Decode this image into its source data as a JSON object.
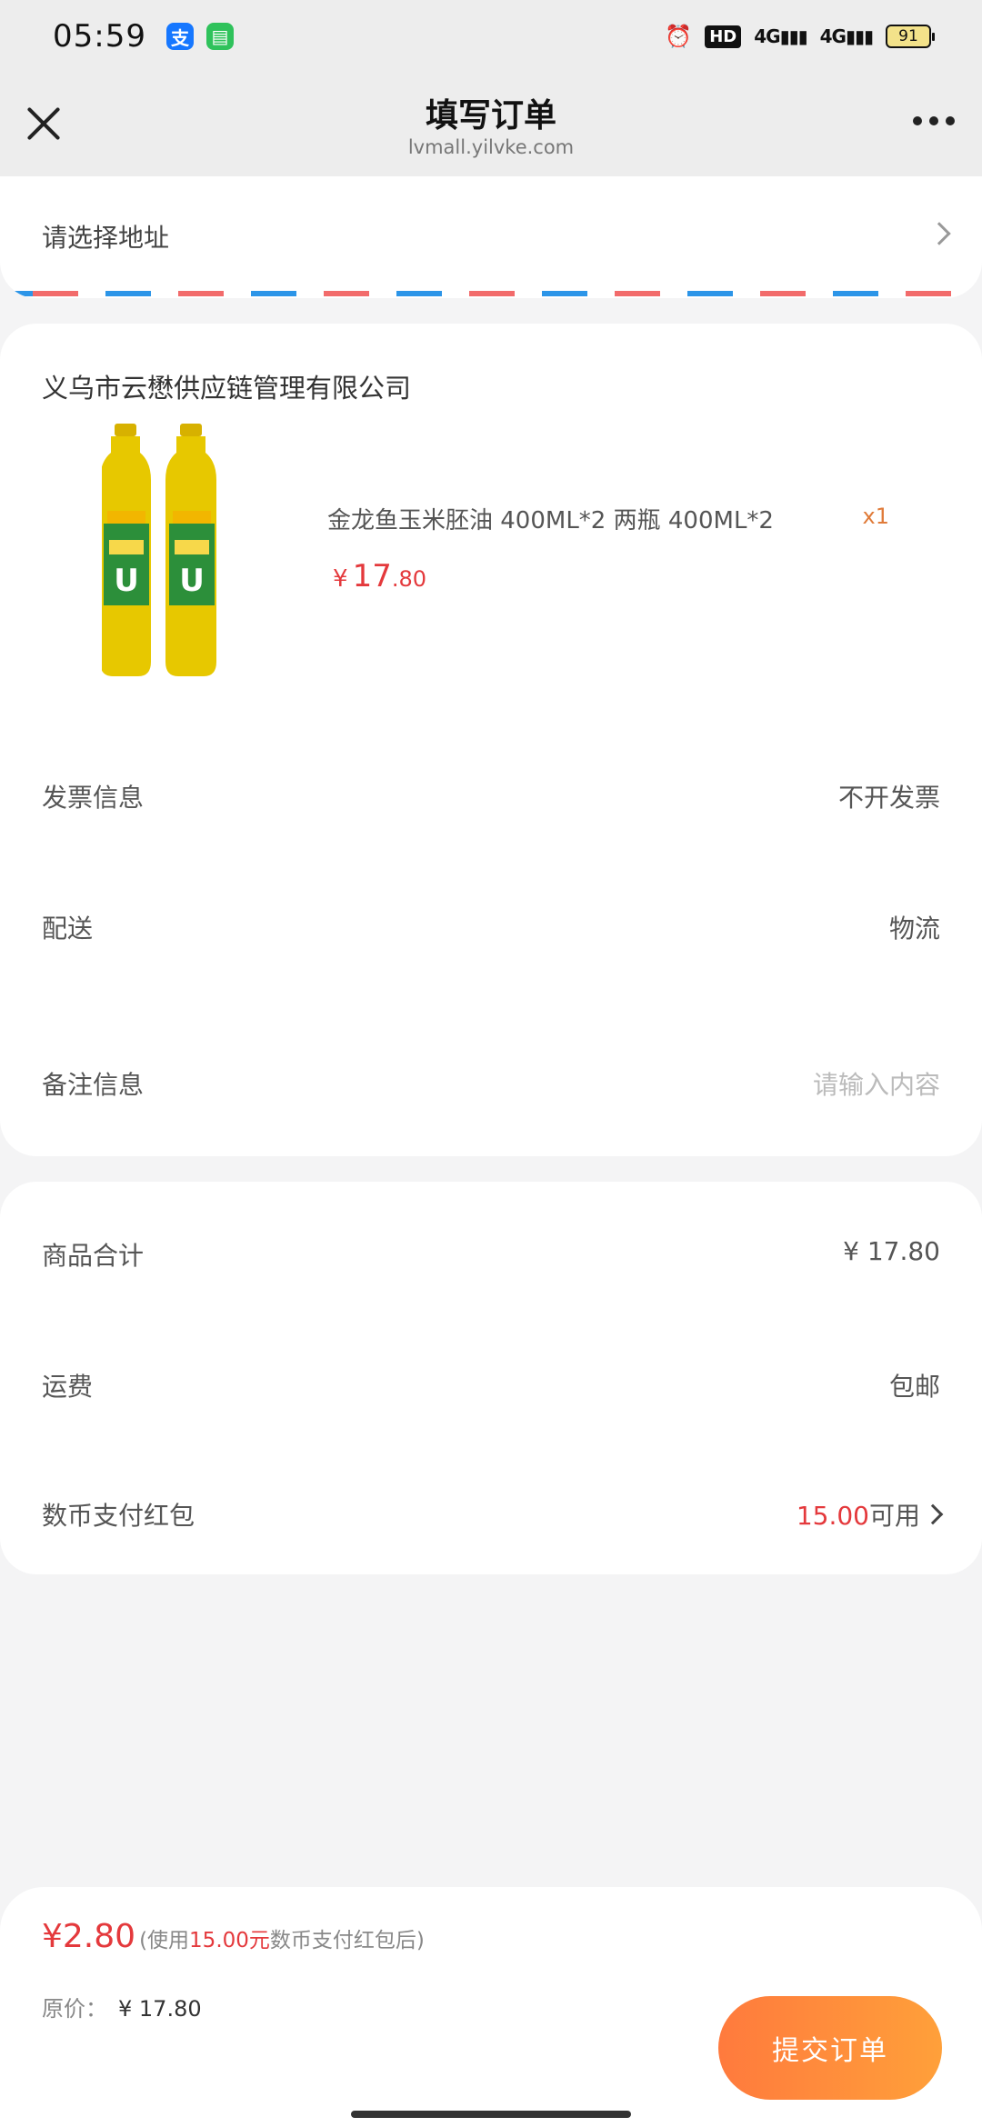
{
  "status_bar": {
    "time": "05:59",
    "alipay_icon": "支",
    "message_icon": "▤",
    "hd_label": "HD",
    "signal_1": "4G",
    "signal_2": "4G",
    "battery": "91"
  },
  "nav": {
    "title": "填写订单",
    "subtitle": "lvmall.yilvke.com"
  },
  "address": {
    "label": "请选择地址"
  },
  "order": {
    "shop_name": "义乌市云懋供应链管理有限公司",
    "product": {
      "name": "金龙鱼玉米胚油 400ML*2 两瓶 400ML*2",
      "quantity": "x1",
      "price_symbol": "¥",
      "price_int": "17",
      "price_dec": ".80"
    },
    "invoice": {
      "label": "发票信息",
      "value": "不开发票"
    },
    "delivery": {
      "label": "配送",
      "value": "物流"
    },
    "remark": {
      "label": "备注信息",
      "placeholder": "请输入内容"
    }
  },
  "summary": {
    "subtotal": {
      "label": "商品合计",
      "value": "¥ 17.80"
    },
    "shipping": {
      "label": "运费",
      "value": "包邮"
    },
    "coin": {
      "label": "数币支付红包",
      "amount": "15.00",
      "suffix": "可用"
    }
  },
  "footer": {
    "pay_amount": "¥2.80",
    "note_prefix": "(使用",
    "note_amount": "15.00元",
    "note_suffix": "数币支付红包后)",
    "original_label": "原价：",
    "original_value": "¥ 17.80",
    "submit_label": "提交订单"
  },
  "colors": {
    "price_red": "#e4393c",
    "button_orange": "#ff8a3c",
    "stripe_red": "#f26b6b",
    "stripe_blue": "#2c95e8"
  }
}
